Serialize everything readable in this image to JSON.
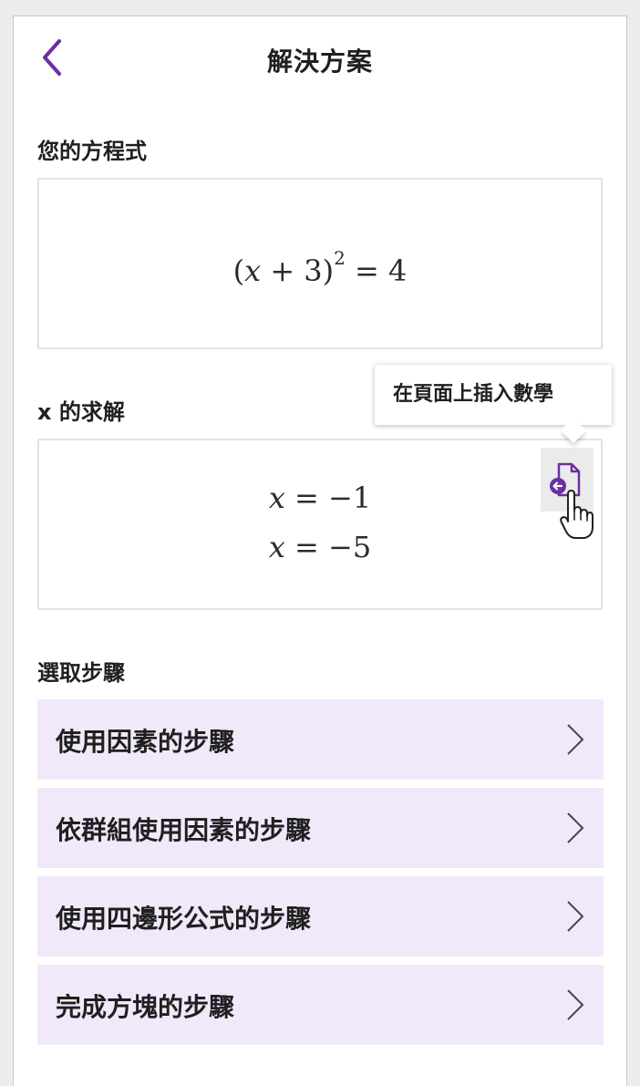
{
  "header": {
    "title": "解決方案",
    "back_icon": "chevron-left-icon",
    "accent_color": "#6b2fa0"
  },
  "equation_section": {
    "label": "您的方程式",
    "equation": {
      "open_paren": "(",
      "var": "x",
      "plus": " + 3)",
      "exponent": "2",
      "rhs": " = 4"
    }
  },
  "solution_section": {
    "label": "x 的求解",
    "solutions": [
      {
        "var": "x",
        "rhs": " = −1"
      },
      {
        "var": "x",
        "rhs": " = −5"
      }
    ],
    "insert_button_icon": "insert-math-icon",
    "tooltip": "在頁面上插入數學"
  },
  "steps_section": {
    "label": "選取步驟",
    "items": [
      {
        "label": "使用因素的步驟"
      },
      {
        "label": "依群組使用因素的步驟"
      },
      {
        "label": "使用四邊形公式的步驟"
      },
      {
        "label": "完成方塊的步驟"
      }
    ],
    "item_background": "#f1e9fa"
  }
}
